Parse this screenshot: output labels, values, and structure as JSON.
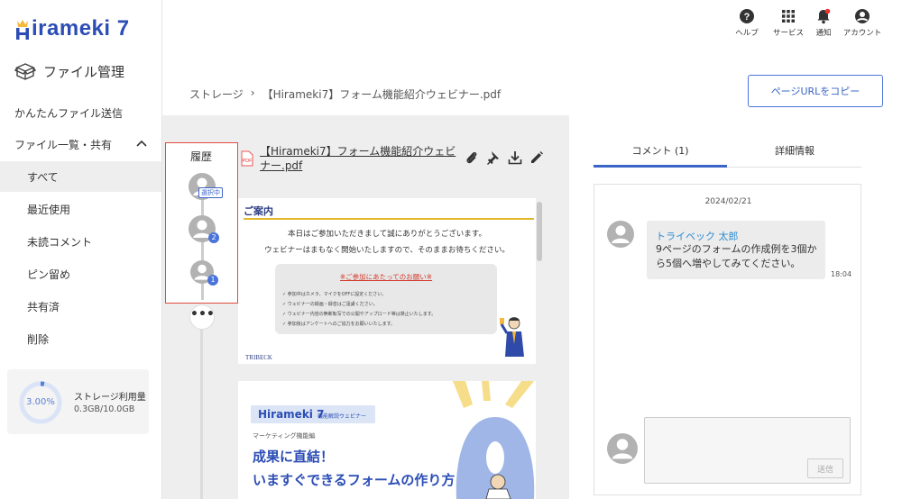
{
  "app": {
    "logo_text": "irameki 7"
  },
  "sidebar": {
    "title": "ファイル管理",
    "items": [
      {
        "label": "かんたんファイル送信"
      },
      {
        "label": "ファイル一覧・共有"
      },
      {
        "label": "すべて"
      },
      {
        "label": "最近使用"
      },
      {
        "label": "未読コメント"
      },
      {
        "label": "ピン留め"
      },
      {
        "label": "共有済"
      },
      {
        "label": "削除"
      }
    ],
    "storage": {
      "percent_label": "3.00%",
      "percent": 3.0,
      "label": "ストレージ利用量",
      "amount": "0.3GB/10.0GB",
      "ring_color": "#5a7fd6"
    }
  },
  "topbar": {
    "help": "ヘルプ",
    "services": "サービス",
    "notifications": "通知",
    "account": "アカウント"
  },
  "breadcrumb": {
    "root": "ストレージ",
    "sep": "›",
    "current": "【Hirameki7】フォーム機能紹介ウェビナー.pdf"
  },
  "copy_url_button": "ページURLをコピー",
  "history": {
    "title": "履歴",
    "selected_tag": "選択中",
    "badges": [
      "2",
      "1"
    ],
    "more": "•••"
  },
  "file": {
    "name": "【Hirameki7】フォーム機能紹介ウェビナー.pdf",
    "type_icon": "PDF"
  },
  "pdf_page1": {
    "heading": "ご案内",
    "line1": "本日はご参加いただきまして誠にありがとうございます。",
    "line2": "ウェビナーはまもなく開始いたしますので、そのままお待ちください。",
    "notice_title": "※ご参加にあたってのお願い※",
    "notice_items": [
      "✓ 参加中はカメラ、マイクをOFFに設定ください。",
      "✓ ウェビナーの録画・録音はご遠慮ください。",
      "✓ ウェビナー内容の無断転写での公開やアップロード等は禁止いたします。",
      "✓ 参加後はアンケートへのご協力をお願いいたします。"
    ],
    "brand": "TRIBECK"
  },
  "pdf_page2": {
    "tag_logo": "Hirameki 7",
    "tag_sub": "機能解説ウェビナー",
    "marketing": "マーケティング機能編",
    "headline1": "成果に直結！",
    "headline2": "いますぐできるフォームの作り方"
  },
  "tabs": [
    {
      "label": "コメント (1)"
    },
    {
      "label": "詳細情報"
    }
  ],
  "comments": {
    "date": "2024/02/21",
    "author": "トライベック 太郎",
    "text": "9ページのフォームの作成例を3個から5個へ増やしてみてください。",
    "time": "18:04",
    "send_button": "送信"
  },
  "colors": {
    "brand": "#2b4db5",
    "accent": "#3b64c8",
    "history_border": "#e24a3b"
  }
}
